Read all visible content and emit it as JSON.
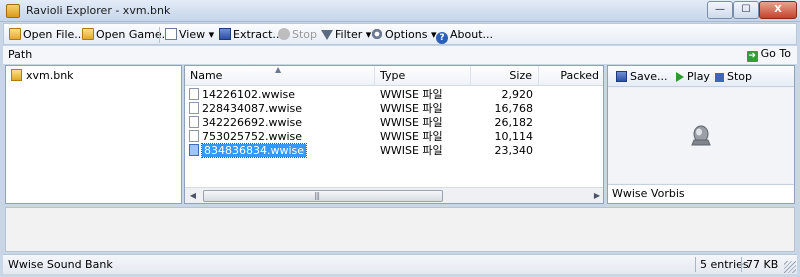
{
  "window": {
    "title": "Ravioli Explorer - xvm.bnk",
    "minimize": "—",
    "maximize": "☐",
    "close": "X"
  },
  "toolbar": {
    "open_file": "Open File...",
    "open_game": "Open Game...",
    "view": "View",
    "extract": "Extract...",
    "stop": "Stop",
    "filter": "Filter",
    "options": "Options",
    "about": "About..."
  },
  "path": {
    "label": "Path",
    "goto": "Go To"
  },
  "tree": {
    "items": [
      {
        "label": "xvm.bnk"
      }
    ]
  },
  "list": {
    "columns": {
      "name": "Name",
      "type": "Type",
      "size": "Size",
      "packed": "Packed"
    },
    "rows": [
      {
        "name": "14226102.wwise",
        "type": "WWISE 파일",
        "size": "2,920",
        "packed": ""
      },
      {
        "name": "228434087.wwise",
        "type": "WWISE 파일",
        "size": "16,768",
        "packed": ""
      },
      {
        "name": "342226692.wwise",
        "type": "WWISE 파일",
        "size": "26,182",
        "packed": ""
      },
      {
        "name": "753025752.wwise",
        "type": "WWISE 파일",
        "size": "10,114",
        "packed": ""
      },
      {
        "name": "834836834.wwise",
        "type": "WWISE 파일",
        "size": "23,340",
        "packed": "",
        "selected": true
      }
    ]
  },
  "player": {
    "save": "Save...",
    "play": "Play",
    "stop": "Stop",
    "codec": "Wwise Vorbis"
  },
  "status": {
    "text": "Wwise Sound Bank",
    "entries": "5 entries",
    "size": "77 KB"
  },
  "colors": {
    "selection": "#3399ff",
    "play_green": "#2f9a2f",
    "chrome": "#c9d6e6"
  }
}
